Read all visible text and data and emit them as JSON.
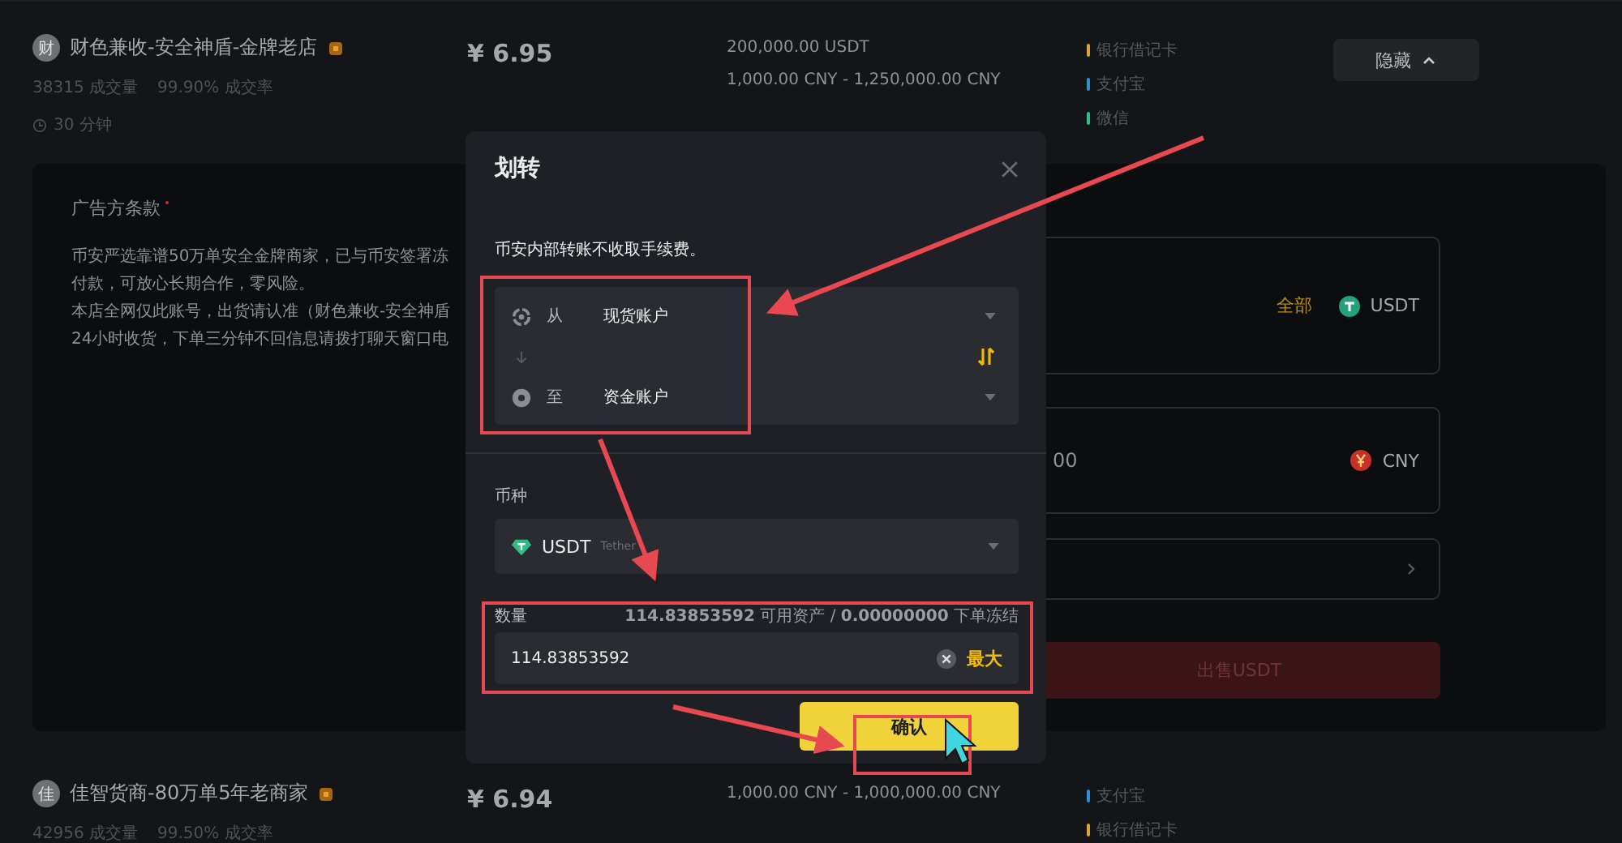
{
  "listings": [
    {
      "avatar_text": "财",
      "name": "财色兼收-安全神盾-金牌老店",
      "trades": "38315 成交量",
      "rate": "99.90% 成交率",
      "time": "30 分钟",
      "price": "¥ 6.95",
      "available": "200,000.00 USDT",
      "limit": "1,000.00 CNY - 1,250,000.00 CNY",
      "payments": [
        {
          "label": "银行借记卡",
          "color": "#d9a53a"
        },
        {
          "label": "支付宝",
          "color": "#2e8fd8"
        },
        {
          "label": "微信",
          "color": "#2ebd85"
        }
      ],
      "action": "隐藏",
      "expanded": true
    },
    {
      "avatar_text": "佳",
      "name": "佳智货商-80万单5年老商家",
      "trades": "42956 成交量",
      "rate": "99.50% 成交率",
      "price": "¥ 6.94",
      "limit": "1,000.00 CNY - 1,000,000.00 CNY",
      "payments": [
        {
          "label": "支付宝",
          "color": "#2e8fd8"
        },
        {
          "label": "银行借记卡",
          "color": "#d9a53a"
        }
      ]
    }
  ],
  "terms": {
    "title": "广告方条款",
    "lines": [
      "币安严选靠谱50万单安全金牌商家，已与币安签署冻",
      "付款，可放心长期合作，零风险。",
      "本店全网仅此账号，出货请认准（财色兼收-安全神盾",
      "24小时收货，下单三分钟不回信息请拨打聊天窗口电"
    ]
  },
  "order_form": {
    "fields": [
      {
        "kind": "crypto",
        "max_label": "全部",
        "currency": "USDT"
      },
      {
        "kind": "fiat",
        "value": "00",
        "currency": "CNY"
      },
      {
        "kind": "select"
      }
    ],
    "submit": "出售USDT"
  },
  "transfer_dialog": {
    "title": "划转",
    "note": "币安内部转账不收取手续费。",
    "from": {
      "label": "从",
      "account": "现货账户"
    },
    "to": {
      "label": "至",
      "account": "资金账户"
    },
    "coin_label": "币种",
    "coin": {
      "symbol": "USDT",
      "name": "Tether"
    },
    "amount_label": "数量",
    "balance": "**114.83853592** 可用资产 / **0.00000000** 下单冻结",
    "amount_value": "114.83853592",
    "max": "最大",
    "confirm": "确认"
  }
}
